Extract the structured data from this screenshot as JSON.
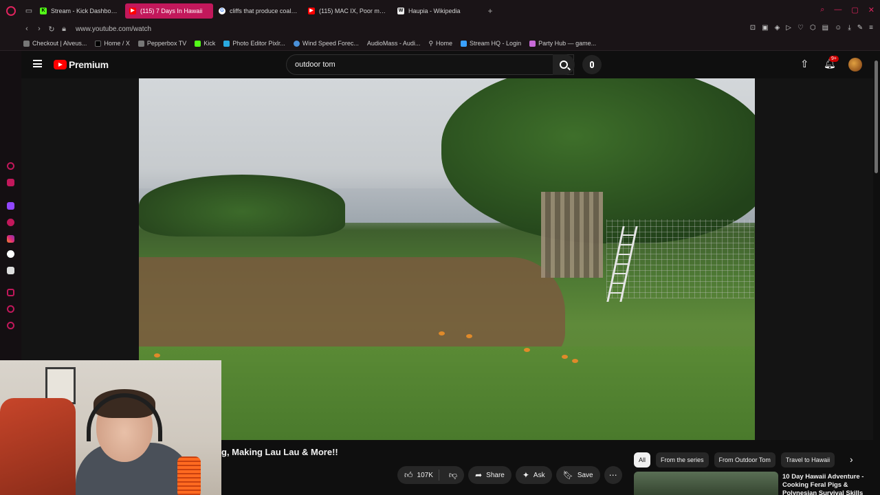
{
  "browser": {
    "tabs": [
      {
        "label": "Stream - Kick Dashboard",
        "favicon": "kick",
        "active": false
      },
      {
        "label": "(115) 7 Days In Hawaii",
        "favicon": "youtube",
        "active": true
      },
      {
        "label": "cliffs that produce coal nat",
        "favicon": "google",
        "active": false
      },
      {
        "label": "(115) MAC IX, Poor man's h",
        "favicon": "youtube",
        "active": false
      },
      {
        "label": "Haupia - Wikipedia",
        "favicon": "wikipedia",
        "active": false
      }
    ],
    "new_tab": "+",
    "url": "www.youtube.com/watch",
    "bookmarks": [
      {
        "label": "Checkout | Alveus..."
      },
      {
        "label": "Home / X"
      },
      {
        "label": "Pepperbox TV"
      },
      {
        "label": "Kick"
      },
      {
        "label": "Photo Editor Pixlr..."
      },
      {
        "label": "Wind Speed Forec..."
      },
      {
        "label": "AudioMass - Audi..."
      },
      {
        "label": "Home"
      },
      {
        "label": "Stream HQ - Login"
      },
      {
        "label": "Party Hub — game..."
      }
    ],
    "accent_color": "#c2185b"
  },
  "youtube": {
    "brand": "Premium",
    "search": {
      "value": "outdoor tom"
    },
    "notifications_badge": "9+",
    "video": {
      "title_visible": "g, Making Lau Lau & More!!",
      "likes": "107K",
      "share_label": "Share",
      "ask_label": "Ask",
      "save_label": "Save"
    },
    "chips": [
      {
        "label": "All",
        "active": true
      },
      {
        "label": "From the series",
        "active": false
      },
      {
        "label": "From Outdoor Tom",
        "active": false
      },
      {
        "label": "Travel to Hawaii",
        "active": false
      }
    ],
    "recommendation": {
      "title": "10 Day Hawaii Adventure - Cooking Feral Pigs & Polynesian Survival Skills"
    }
  }
}
